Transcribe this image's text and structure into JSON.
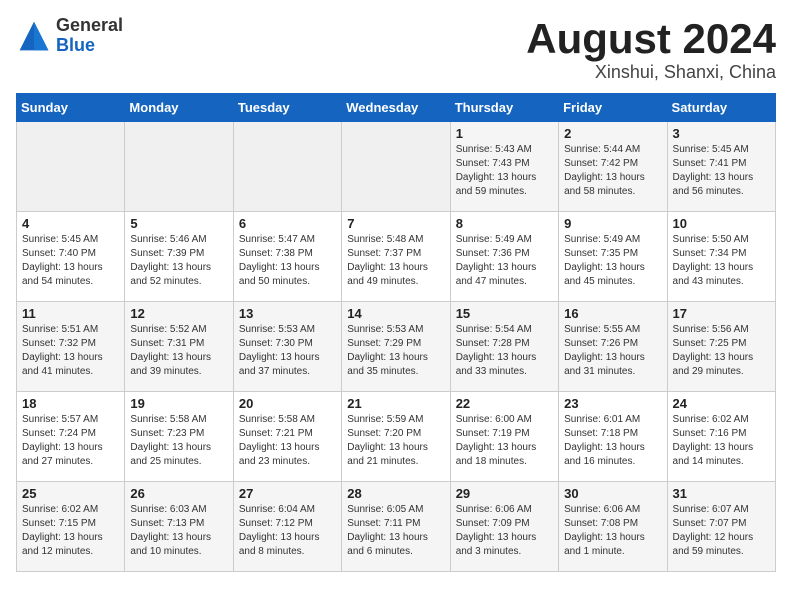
{
  "header": {
    "logo_general": "General",
    "logo_blue": "Blue",
    "month_year": "August 2024",
    "location": "Xinshui, Shanxi, China"
  },
  "weekdays": [
    "Sunday",
    "Monday",
    "Tuesday",
    "Wednesday",
    "Thursday",
    "Friday",
    "Saturday"
  ],
  "weeks": [
    [
      {
        "day": "",
        "info": ""
      },
      {
        "day": "",
        "info": ""
      },
      {
        "day": "",
        "info": ""
      },
      {
        "day": "",
        "info": ""
      },
      {
        "day": "1",
        "info": "Sunrise: 5:43 AM\nSunset: 7:43 PM\nDaylight: 13 hours\nand 59 minutes."
      },
      {
        "day": "2",
        "info": "Sunrise: 5:44 AM\nSunset: 7:42 PM\nDaylight: 13 hours\nand 58 minutes."
      },
      {
        "day": "3",
        "info": "Sunrise: 5:45 AM\nSunset: 7:41 PM\nDaylight: 13 hours\nand 56 minutes."
      }
    ],
    [
      {
        "day": "4",
        "info": "Sunrise: 5:45 AM\nSunset: 7:40 PM\nDaylight: 13 hours\nand 54 minutes."
      },
      {
        "day": "5",
        "info": "Sunrise: 5:46 AM\nSunset: 7:39 PM\nDaylight: 13 hours\nand 52 minutes."
      },
      {
        "day": "6",
        "info": "Sunrise: 5:47 AM\nSunset: 7:38 PM\nDaylight: 13 hours\nand 50 minutes."
      },
      {
        "day": "7",
        "info": "Sunrise: 5:48 AM\nSunset: 7:37 PM\nDaylight: 13 hours\nand 49 minutes."
      },
      {
        "day": "8",
        "info": "Sunrise: 5:49 AM\nSunset: 7:36 PM\nDaylight: 13 hours\nand 47 minutes."
      },
      {
        "day": "9",
        "info": "Sunrise: 5:49 AM\nSunset: 7:35 PM\nDaylight: 13 hours\nand 45 minutes."
      },
      {
        "day": "10",
        "info": "Sunrise: 5:50 AM\nSunset: 7:34 PM\nDaylight: 13 hours\nand 43 minutes."
      }
    ],
    [
      {
        "day": "11",
        "info": "Sunrise: 5:51 AM\nSunset: 7:32 PM\nDaylight: 13 hours\nand 41 minutes."
      },
      {
        "day": "12",
        "info": "Sunrise: 5:52 AM\nSunset: 7:31 PM\nDaylight: 13 hours\nand 39 minutes."
      },
      {
        "day": "13",
        "info": "Sunrise: 5:53 AM\nSunset: 7:30 PM\nDaylight: 13 hours\nand 37 minutes."
      },
      {
        "day": "14",
        "info": "Sunrise: 5:53 AM\nSunset: 7:29 PM\nDaylight: 13 hours\nand 35 minutes."
      },
      {
        "day": "15",
        "info": "Sunrise: 5:54 AM\nSunset: 7:28 PM\nDaylight: 13 hours\nand 33 minutes."
      },
      {
        "day": "16",
        "info": "Sunrise: 5:55 AM\nSunset: 7:26 PM\nDaylight: 13 hours\nand 31 minutes."
      },
      {
        "day": "17",
        "info": "Sunrise: 5:56 AM\nSunset: 7:25 PM\nDaylight: 13 hours\nand 29 minutes."
      }
    ],
    [
      {
        "day": "18",
        "info": "Sunrise: 5:57 AM\nSunset: 7:24 PM\nDaylight: 13 hours\nand 27 minutes."
      },
      {
        "day": "19",
        "info": "Sunrise: 5:58 AM\nSunset: 7:23 PM\nDaylight: 13 hours\nand 25 minutes."
      },
      {
        "day": "20",
        "info": "Sunrise: 5:58 AM\nSunset: 7:21 PM\nDaylight: 13 hours\nand 23 minutes."
      },
      {
        "day": "21",
        "info": "Sunrise: 5:59 AM\nSunset: 7:20 PM\nDaylight: 13 hours\nand 21 minutes."
      },
      {
        "day": "22",
        "info": "Sunrise: 6:00 AM\nSunset: 7:19 PM\nDaylight: 13 hours\nand 18 minutes."
      },
      {
        "day": "23",
        "info": "Sunrise: 6:01 AM\nSunset: 7:18 PM\nDaylight: 13 hours\nand 16 minutes."
      },
      {
        "day": "24",
        "info": "Sunrise: 6:02 AM\nSunset: 7:16 PM\nDaylight: 13 hours\nand 14 minutes."
      }
    ],
    [
      {
        "day": "25",
        "info": "Sunrise: 6:02 AM\nSunset: 7:15 PM\nDaylight: 13 hours\nand 12 minutes."
      },
      {
        "day": "26",
        "info": "Sunrise: 6:03 AM\nSunset: 7:13 PM\nDaylight: 13 hours\nand 10 minutes."
      },
      {
        "day": "27",
        "info": "Sunrise: 6:04 AM\nSunset: 7:12 PM\nDaylight: 13 hours\nand 8 minutes."
      },
      {
        "day": "28",
        "info": "Sunrise: 6:05 AM\nSunset: 7:11 PM\nDaylight: 13 hours\nand 6 minutes."
      },
      {
        "day": "29",
        "info": "Sunrise: 6:06 AM\nSunset: 7:09 PM\nDaylight: 13 hours\nand 3 minutes."
      },
      {
        "day": "30",
        "info": "Sunrise: 6:06 AM\nSunset: 7:08 PM\nDaylight: 13 hours\nand 1 minute."
      },
      {
        "day": "31",
        "info": "Sunrise: 6:07 AM\nSunset: 7:07 PM\nDaylight: 12 hours\nand 59 minutes."
      }
    ]
  ]
}
